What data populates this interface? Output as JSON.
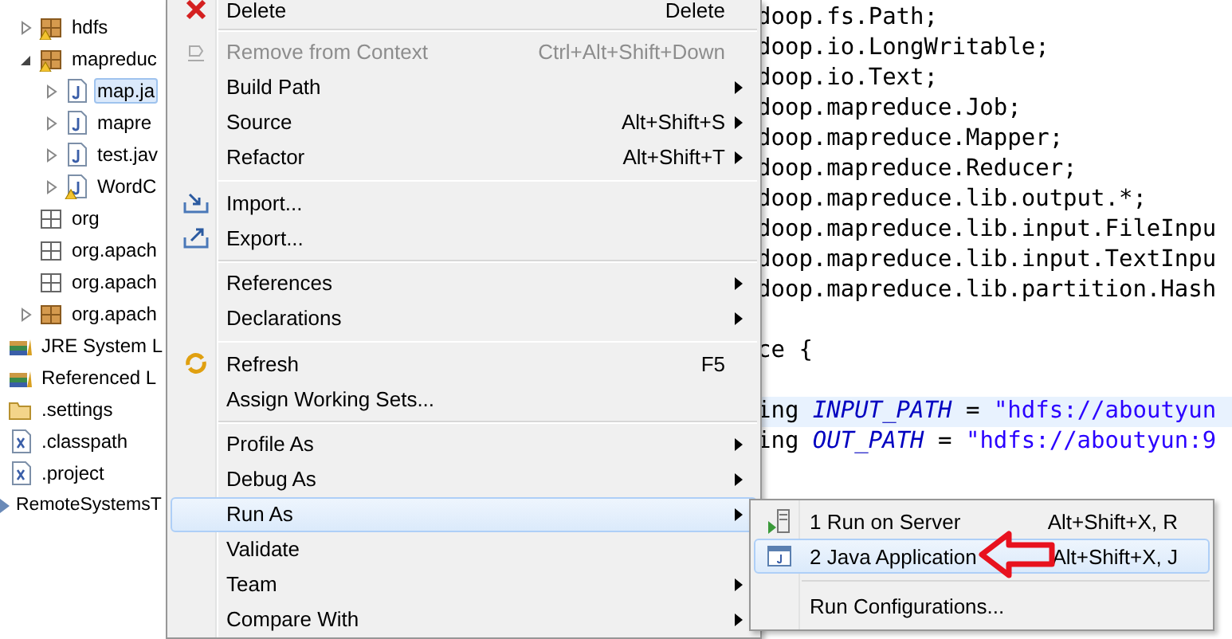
{
  "tree": {
    "packages": [
      {
        "label": "hdfs",
        "kind": "package",
        "warning": true,
        "expanded": false
      },
      {
        "label": "mapreduc",
        "kind": "package",
        "warning": true,
        "expanded": true,
        "children": [
          {
            "label": "map.ja",
            "kind": "java-file",
            "warning": false,
            "expanded": false,
            "selected": true
          },
          {
            "label": "mapre",
            "kind": "java-file",
            "warning": false,
            "expanded": false,
            "selected": false
          },
          {
            "label": "test.jav",
            "kind": "java-file",
            "warning": false,
            "expanded": false,
            "selected": false
          },
          {
            "label": "WordC",
            "kind": "java-file",
            "warning": true,
            "expanded": false,
            "selected": false
          }
        ]
      },
      {
        "label": "org",
        "kind": "empty-package",
        "warning": false
      },
      {
        "label": "org.apach",
        "kind": "empty-package",
        "warning": false
      },
      {
        "label": "org.apach",
        "kind": "empty-package",
        "warning": false
      },
      {
        "label": "org.apach",
        "kind": "package",
        "warning": false,
        "expanded": false
      }
    ],
    "project_items": [
      {
        "label": "JRE System L",
        "kind": "library"
      },
      {
        "label": "Referenced L",
        "kind": "library"
      },
      {
        "label": ".settings",
        "kind": "folder"
      },
      {
        "label": ".classpath",
        "kind": "xml-file"
      },
      {
        "label": ".project",
        "kind": "xml-file"
      }
    ],
    "projects": [
      {
        "label": "RemoteSystemsT",
        "kind": "project"
      }
    ]
  },
  "context_menu": {
    "groups": [
      [
        {
          "label": "Delete",
          "shortcut": "Delete",
          "kind": "delete",
          "disabled": false,
          "submenu": false,
          "selected": false
        }
      ],
      [
        {
          "label": "Remove from Context",
          "shortcut": "Ctrl+Alt+Shift+Down",
          "kind": "remove",
          "disabled": true,
          "submenu": false,
          "selected": false
        },
        {
          "label": "Build Path",
          "kind": "plain",
          "disabled": false,
          "submenu": true,
          "selected": false
        },
        {
          "label": "Source",
          "shortcut": "Alt+Shift+S",
          "kind": "plain",
          "disabled": false,
          "submenu": true,
          "selected": false
        },
        {
          "label": "Refactor",
          "shortcut": "Alt+Shift+T",
          "kind": "plain",
          "disabled": false,
          "submenu": true,
          "selected": false
        }
      ],
      [
        {
          "label": "Import...",
          "kind": "import",
          "disabled": false,
          "submenu": false,
          "selected": false
        },
        {
          "label": "Export...",
          "kind": "export",
          "disabled": false,
          "submenu": false,
          "selected": false
        }
      ],
      [
        {
          "label": "References",
          "kind": "plain",
          "disabled": false,
          "submenu": true,
          "selected": false
        },
        {
          "label": "Declarations",
          "kind": "plain",
          "disabled": false,
          "submenu": true,
          "selected": false
        }
      ],
      [
        {
          "label": "Refresh",
          "shortcut": "F5",
          "kind": "refresh",
          "disabled": false,
          "submenu": false,
          "selected": false
        },
        {
          "label": "Assign Working Sets...",
          "kind": "plain",
          "disabled": false,
          "submenu": false,
          "selected": false
        }
      ],
      [
        {
          "label": "Profile As",
          "kind": "plain",
          "disabled": false,
          "submenu": true,
          "selected": false
        },
        {
          "label": "Debug As",
          "kind": "plain",
          "disabled": false,
          "submenu": true,
          "selected": false
        },
        {
          "label": "Run As",
          "kind": "plain",
          "disabled": false,
          "submenu": true,
          "selected": true
        },
        {
          "label": "Validate",
          "kind": "plain",
          "disabled": false,
          "submenu": false,
          "selected": false
        },
        {
          "label": "Team",
          "kind": "plain",
          "disabled": false,
          "submenu": true,
          "selected": false
        },
        {
          "label": "Compare With",
          "kind": "plain",
          "disabled": false,
          "submenu": true,
          "selected": false
        }
      ]
    ]
  },
  "submenu": {
    "groups": [
      [
        {
          "label": "1 Run on Server",
          "shortcut": "Alt+Shift+X, R",
          "kind": "server",
          "selected": false
        },
        {
          "label": "2 Java Application",
          "shortcut": "Alt+Shift+X, J",
          "kind": "java-app",
          "selected": true
        }
      ],
      [
        {
          "label": "Run Configurations...",
          "kind": "plain",
          "selected": false
        }
      ]
    ]
  },
  "editor": {
    "lines": [
      {
        "highlighted": false,
        "parts": [
          {
            "kind": "plain",
            "text": "doop.fs.Path;"
          }
        ]
      },
      {
        "highlighted": false,
        "parts": [
          {
            "kind": "plain",
            "text": "doop.io.LongWritable;"
          }
        ]
      },
      {
        "highlighted": false,
        "parts": [
          {
            "kind": "plain",
            "text": "doop.io.Text;"
          }
        ]
      },
      {
        "highlighted": false,
        "parts": [
          {
            "kind": "plain",
            "text": "doop.mapreduce.Job;"
          }
        ]
      },
      {
        "highlighted": false,
        "parts": [
          {
            "kind": "plain",
            "text": "doop.mapreduce.Mapper;"
          }
        ]
      },
      {
        "highlighted": false,
        "parts": [
          {
            "kind": "plain",
            "text": "doop.mapreduce.Reducer;"
          }
        ]
      },
      {
        "highlighted": false,
        "parts": [
          {
            "kind": "plain",
            "text": "doop.mapreduce.lib.output.*;"
          }
        ]
      },
      {
        "highlighted": false,
        "parts": [
          {
            "kind": "plain",
            "text": "doop.mapreduce.lib.input.FileInpu"
          }
        ]
      },
      {
        "highlighted": false,
        "parts": [
          {
            "kind": "plain",
            "text": "doop.mapreduce.lib.input.TextInpu"
          }
        ]
      },
      {
        "highlighted": false,
        "parts": [
          {
            "kind": "plain",
            "text": "doop.mapreduce.lib.partition.Hash"
          }
        ]
      },
      {
        "highlighted": false
      },
      {
        "highlighted": false,
        "parts": [
          {
            "kind": "plain",
            "text": "ce {"
          }
        ]
      },
      {
        "highlighted": false
      },
      {
        "highlighted": true,
        "parts": [
          {
            "kind": "plain",
            "text": "ing "
          },
          {
            "kind": "field",
            "text": "INPUT_PATH"
          },
          {
            "kind": "plain",
            "text": " = "
          },
          {
            "kind": "string",
            "text": "\"hdfs://aboutyun"
          }
        ]
      },
      {
        "highlighted": false,
        "parts": [
          {
            "kind": "plain",
            "text": "ing "
          },
          {
            "kind": "field",
            "text": "OUT_PATH"
          },
          {
            "kind": "plain",
            "text": " = "
          },
          {
            "kind": "string",
            "text": "\"hdfs://aboutyun:9"
          }
        ]
      }
    ]
  }
}
